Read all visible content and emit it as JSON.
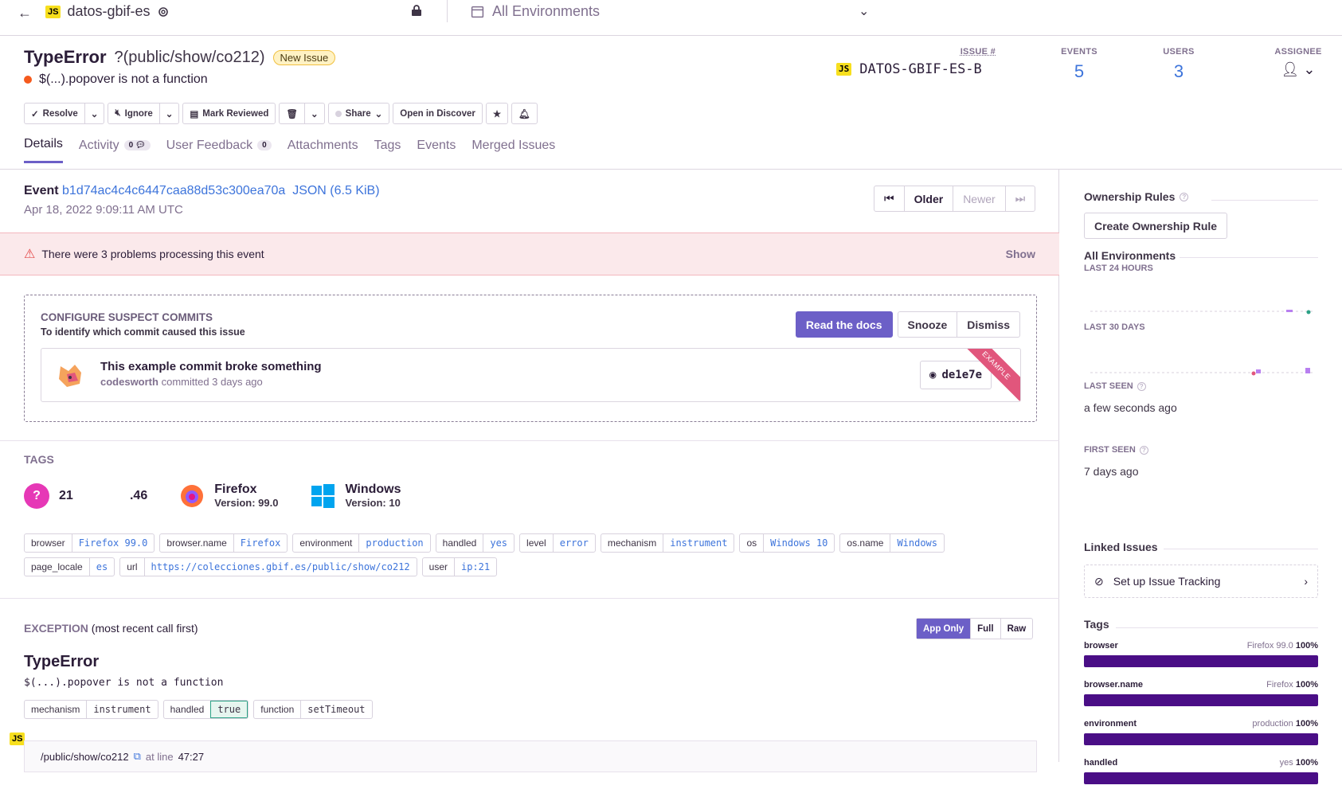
{
  "topbar": {
    "project": "datos-gbif-es",
    "environment": "All Environments"
  },
  "issue": {
    "type": "TypeError",
    "location": "?(public/show/co212)",
    "badge": "New Issue",
    "message": "$(...).popover is not a function",
    "issue_label": "ISSUE #",
    "issue_id": "DATOS-GBIF-ES-B",
    "events_label": "EVENTS",
    "events": "5",
    "users_label": "USERS",
    "users": "3",
    "assignee_label": "ASSIGNEE"
  },
  "actions": {
    "resolve": "Resolve",
    "ignore": "Ignore",
    "mark_reviewed": "Mark Reviewed",
    "share": "Share",
    "discover": "Open in Discover"
  },
  "tabs": [
    {
      "label": "Details"
    },
    {
      "label": "Activity",
      "count": "0"
    },
    {
      "label": "User Feedback",
      "count": "0"
    },
    {
      "label": "Attachments"
    },
    {
      "label": "Tags"
    },
    {
      "label": "Events"
    },
    {
      "label": "Merged Issues"
    }
  ],
  "event": {
    "label": "Event",
    "id": "b1d74ac4c4c6447caa88d53c300ea70a",
    "json": "JSON (6.5 KiB)",
    "date": "Apr 18, 2022 9:09:11 AM UTC",
    "older": "Older",
    "newer": "Newer"
  },
  "alert": {
    "text": "There were 3 problems processing this event",
    "show": "Show"
  },
  "suspect": {
    "heading": "Configure Suspect Commits",
    "subheading": "To identify which commit caused this issue",
    "docs": "Read the docs",
    "snooze": "Snooze",
    "dismiss": "Dismiss",
    "commit_title": "This example commit broke something",
    "commit_author": "codesworth",
    "commit_time": "committed 3 days ago",
    "sha": "de1e7e",
    "ribbon": "EXAMPLE"
  },
  "tags_section": {
    "heading": "TAGS",
    "ip": "21        .46",
    "browser_name": "Firefox",
    "browser_version": "Version: 99.0",
    "os_name": "Windows",
    "os_version": "Version: 10",
    "pills": [
      {
        "k": "browser",
        "v": "Firefox 99.0"
      },
      {
        "k": "browser.name",
        "v": "Firefox"
      },
      {
        "k": "environment",
        "v": "production"
      },
      {
        "k": "handled",
        "v": "yes"
      },
      {
        "k": "level",
        "v": "error"
      },
      {
        "k": "mechanism",
        "v": "instrument"
      },
      {
        "k": "os",
        "v": "Windows 10"
      },
      {
        "k": "os.name",
        "v": "Windows"
      },
      {
        "k": "page_locale",
        "v": "es"
      },
      {
        "k": "url",
        "v": "https://colecciones.gbif.es/public/show/co212"
      },
      {
        "k": "user",
        "v": "ip:21"
      }
    ]
  },
  "exception": {
    "heading": "EXCEPTION",
    "heading_sub": "(most recent call first)",
    "app_only": "App Only",
    "full": "Full",
    "raw": "Raw",
    "name": "TypeError",
    "message": "$(...).popover is not a function",
    "pills": [
      {
        "k": "mechanism",
        "v": "instrument"
      },
      {
        "k": "handled",
        "v": "true"
      },
      {
        "k": "function",
        "v": "setTimeout"
      }
    ],
    "frame_file": "/public/show/co212",
    "frame_at": "at line",
    "frame_line": "47:27"
  },
  "sidebar": {
    "ownership": "Ownership Rules",
    "create_rule": "Create Ownership Rule",
    "environments": "All Environments",
    "last24": "LAST 24 HOURS",
    "last30": "LAST 30 DAYS",
    "last_seen_label": "LAST SEEN",
    "last_seen": "a few seconds ago",
    "first_seen_label": "FIRST SEEN",
    "first_seen": "7 days ago",
    "linked": "Linked Issues",
    "tracking": "Set up Issue Tracking",
    "tags_heading": "Tags",
    "tags": [
      {
        "name": "browser",
        "value": "Firefox 99.0",
        "pct": "100%"
      },
      {
        "name": "browser.name",
        "value": "Firefox",
        "pct": "100%"
      },
      {
        "name": "environment",
        "value": "production",
        "pct": "100%"
      },
      {
        "name": "handled",
        "value": "yes",
        "pct": "100%"
      }
    ]
  },
  "colors": {
    "accent": "#6c5fc7",
    "link": "#3d74db",
    "error": "#f55a1d",
    "bar": "#4a0e86"
  }
}
